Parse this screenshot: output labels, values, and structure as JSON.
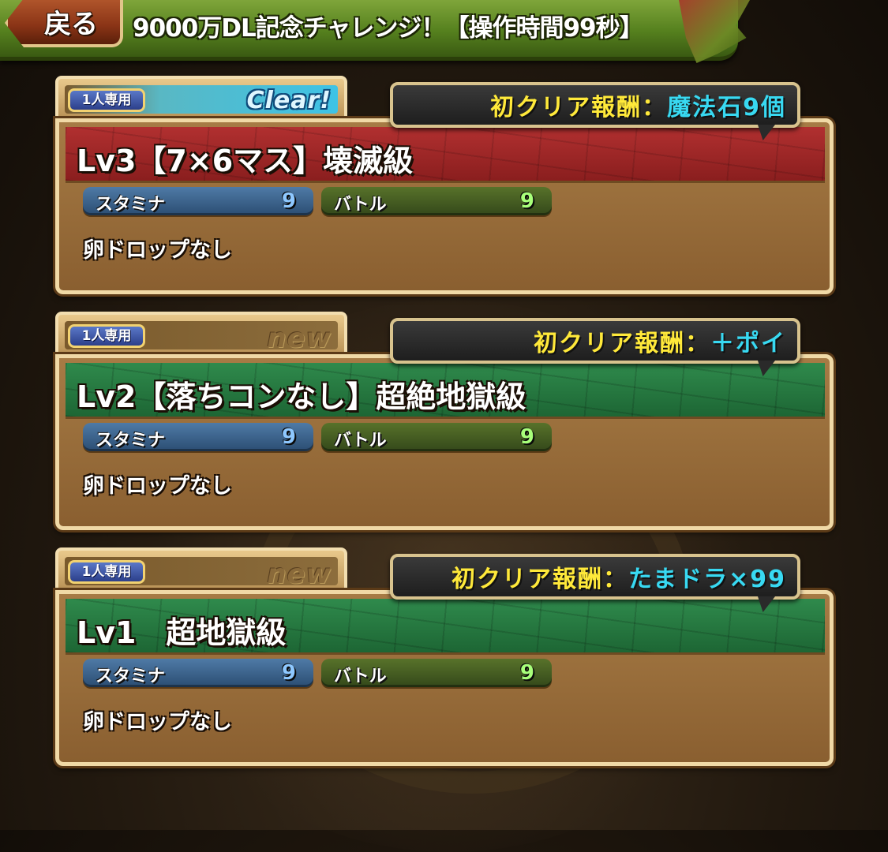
{
  "header": {
    "back_label": "戻る",
    "title": "9000万DL記念チャレンジ！【操作時間99秒】"
  },
  "dungeons": [
    {
      "solo_label": "1人専用",
      "status": "Clear!",
      "status_type": "clear",
      "reward_label": "初クリア報酬：",
      "reward_value": "魔法石9個",
      "title": "Lv3【7×6マス】壊滅級",
      "title_color": "#b13030",
      "stamina_label": "スタミナ",
      "stamina_value": "9",
      "battle_label": "バトル",
      "battle_value": "9",
      "drop_text": "卵ドロップなし"
    },
    {
      "solo_label": "1人専用",
      "status": "new",
      "status_type": "new",
      "reward_label": "初クリア報酬：",
      "reward_value": "＋ポイ",
      "title": "Lv2【落ちコンなし】超絶地獄級",
      "title_color": "#2f8a4c",
      "stamina_label": "スタミナ",
      "stamina_value": "9",
      "battle_label": "バトル",
      "battle_value": "9",
      "drop_text": "卵ドロップなし"
    },
    {
      "solo_label": "1人専用",
      "status": "new",
      "status_type": "new",
      "reward_label": "初クリア報酬：",
      "reward_value": "たまドラ×99",
      "title": "Lv1　超地獄級",
      "title_color": "#2f8a4c",
      "stamina_label": "スタミナ",
      "stamina_value": "9",
      "battle_label": "バトル",
      "battle_value": "9",
      "drop_text": "卵ドロップなし"
    }
  ]
}
